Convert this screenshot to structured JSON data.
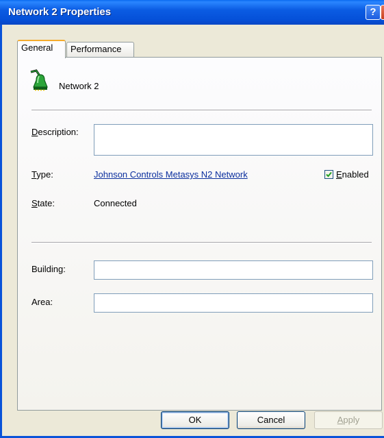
{
  "window": {
    "title": "Network 2 Properties",
    "help_glyph": "?",
    "close_glyph": "X"
  },
  "tabs": [
    {
      "label": "General",
      "active": true
    },
    {
      "label": "Performance",
      "active": false
    }
  ],
  "general": {
    "name": "Network 2",
    "description": {
      "label_mnemonic": "D",
      "label_rest": "escription:",
      "value": ""
    },
    "type": {
      "label_mnemonic": "T",
      "label_rest": "ype:",
      "value": "Johnson Controls Metasys N2 Network"
    },
    "enabled": {
      "label_mnemonic": "E",
      "label_rest": "nabled",
      "checked": true
    },
    "state": {
      "label_mnemonic": "S",
      "label_rest": "tate:",
      "value": "Connected"
    },
    "building": {
      "label": "Building:",
      "value": ""
    },
    "area": {
      "label": "Area:",
      "value": ""
    }
  },
  "buttons": {
    "ok": {
      "mnemonic": "",
      "label": "OK"
    },
    "cancel": {
      "label": "Cancel"
    },
    "apply": {
      "mnemonic": "A",
      "rest": "pply",
      "disabled": true
    }
  },
  "colors": {
    "titlebar": "#0b5ce3",
    "link": "#0b2f9e",
    "tab_highlight": "#f5ac2d",
    "icon_green": "#2ca53a"
  },
  "icons": {
    "network": "network-bell-icon",
    "check": "checkmark-icon"
  }
}
